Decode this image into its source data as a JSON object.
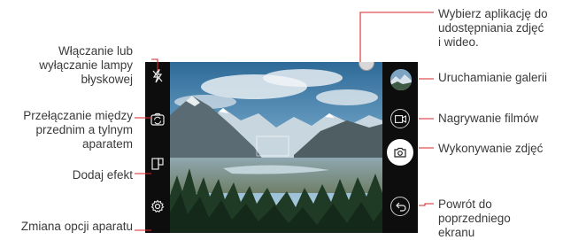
{
  "labels": {
    "flash": [
      "Włączanie lub",
      "wyłączanie lampy",
      "błyskowej"
    ],
    "switch_camera": [
      "Przełączanie między",
      "przednim a tylnym",
      "aparatem"
    ],
    "add_effect": "Dodaj efekt",
    "camera_options": "Zmiana opcji aparatu",
    "share_app": [
      "Wybierz aplikację do",
      "udostępniania zdjęć",
      "i wideo."
    ],
    "open_gallery": "Uruchamianie galerii",
    "record_video": "Nagrywanie filmów",
    "take_photo": "Wykonywanie zdjęć",
    "back": [
      "Powrót do",
      "poprzedniego",
      "ekranu"
    ]
  },
  "icons": {
    "flash": "flash-off-icon",
    "switch_camera": "switch-camera-icon",
    "effect": "effect-icon",
    "settings": "gear-icon",
    "share": "share-app-icon",
    "gallery": "gallery-thumbnail",
    "video": "video-record-icon",
    "shutter": "shutter-camera-icon",
    "back": "back-icon"
  },
  "colors": {
    "label_text": "#3a3a3a",
    "leader_line": "#d9262b",
    "strip_bg": "#0d0d0d",
    "shutter_bg": "#ffffff"
  }
}
